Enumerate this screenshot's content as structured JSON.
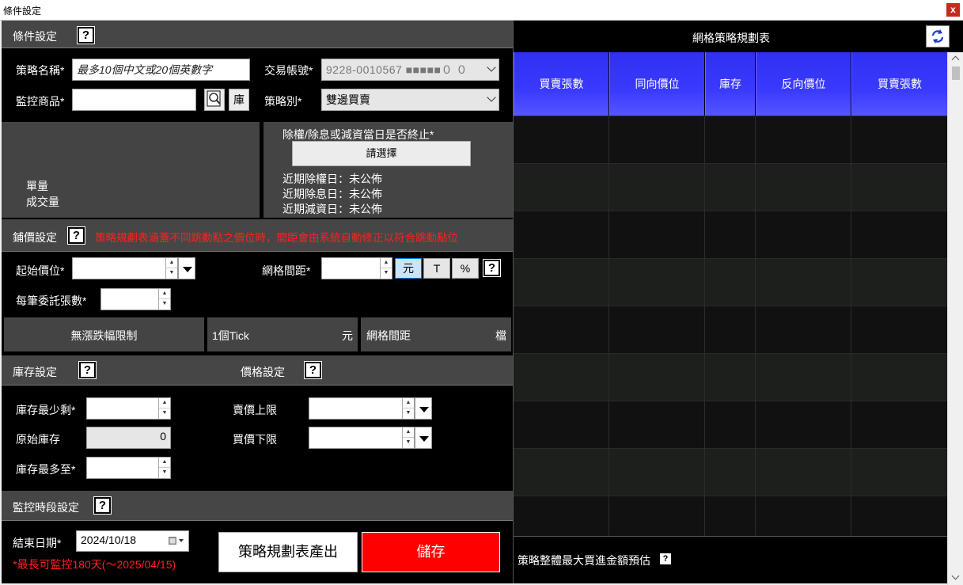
{
  "window": {
    "title": "條件設定",
    "close_glyph": "x"
  },
  "condition": {
    "header": "條件設定",
    "strategy_name_label": "策略名稱*",
    "strategy_name_placeholder": "最多10個中文或20個英數字",
    "account_label": "交易帳號*",
    "account_value": "9228-0010567 ■■■■■０ ０",
    "product_label": "監控商品*",
    "product_value": "",
    "library_button": "庫",
    "strategy_type_label": "策略別*",
    "strategy_type_value": "雙邊買賣",
    "volume_line1": "單量",
    "volume_line2": "成交量",
    "exright_question": "除權/除息或減資當日是否終止*",
    "exright_select": "請選擇",
    "recent_exright": "近期除權日：未公佈",
    "recent_exdiv": "近期除息日：未公佈",
    "recent_capred": "近期減資日：未公佈"
  },
  "pricing": {
    "header": "鋪價設定",
    "warning": "策略規劃表涵蓋不同跳動點之價位時，間距會由系統自動修正以符合跳動點位",
    "start_price_label": "起始價位*",
    "grid_spacing_label": "網格間距*",
    "unit_yuan": "元",
    "unit_tick": "T",
    "unit_pct": "%",
    "lots_label": "每筆委託張數*",
    "no_limit": "無漲跌幅限制",
    "tick_label": "1個Tick",
    "tick_unit": "元",
    "spacing_label": "網格間距",
    "spacing_unit": "檔"
  },
  "inventory": {
    "header": "庫存設定",
    "min_label": "庫存最少剩*",
    "orig_label": "原始庫存",
    "orig_value": "0",
    "max_label": "庫存最多至*"
  },
  "price_setting": {
    "header": "價格設定",
    "sell_upper_label": "賣價上限",
    "buy_lower_label": "買價下限"
  },
  "monitor": {
    "header": "監控時段設定",
    "end_date_label": "結束日期*",
    "end_date_value": "2024/10/18",
    "note": "*最長可監控180天(～2025/04/15)",
    "generate_button": "策略規劃表產出",
    "save_button": "儲存"
  },
  "grid": {
    "title": "網格策略規劃表",
    "columns": [
      "買賣張數",
      "同向價位",
      "庫存",
      "反向價位",
      "買賣張數"
    ],
    "summary": "策略整體最大買進金額預估"
  },
  "colors": {
    "accent_blue": "#3a3aff",
    "save_red": "#ff0000",
    "warning_red": "#ff2020"
  }
}
